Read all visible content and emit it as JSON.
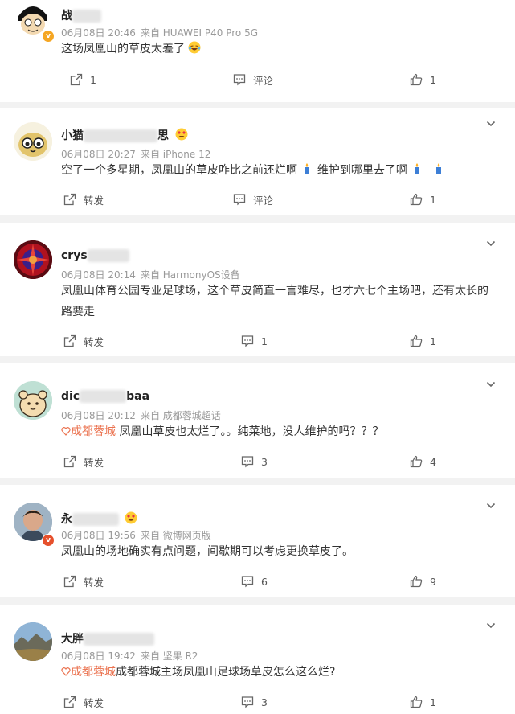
{
  "posts": [
    {
      "name_visible": "战",
      "time": "06月08日 20:46",
      "source": "来自 HUAWEI P40 Pro 5G",
      "text": "这场凤凰山的草皮太差了",
      "text_suffix_emoji": "laugh-cry-emoji",
      "actions": {
        "share": "1",
        "comment": "评论",
        "like": "1"
      }
    },
    {
      "name_visible": "小猫",
      "name_visible_end": "思",
      "time": "06月08日 20:27",
      "source": "来自 iPhone 12",
      "text_a": "空了一个多星期，凤凰山的草皮咋比之前还烂啊",
      "text_b": "维护到哪里去了啊",
      "actions": {
        "share": "转发",
        "comment": "评论",
        "like": "1"
      }
    },
    {
      "name_visible": "crys",
      "time": "06月08日 20:14",
      "source": "来自 HarmonyOS设备",
      "text": "凤凰山体育公园专业足球场，这个草皮简直一言难尽，也才六七个主场吧，还有太长的路要走",
      "actions": {
        "share": "转发",
        "comment": "1",
        "like": "1"
      }
    },
    {
      "name_visible": "dic",
      "name_visible_end": "baa",
      "time": "06月08日 20:12",
      "source": "来自 成都蓉城超话",
      "tag": "成都蓉城",
      "text": "凤凰山草皮也太烂了。。纯菜地，没人维护的吗？？？",
      "actions": {
        "share": "转发",
        "comment": "3",
        "like": "4"
      }
    },
    {
      "name_visible": "永",
      "time": "06月08日 19:56",
      "source": "来自 微博网页版",
      "text": "凤凰山的场地确实有点问题，间歇期可以考虑更换草皮了。",
      "actions": {
        "share": "转发",
        "comment": "6",
        "like": "9"
      }
    },
    {
      "name_visible": "大胖",
      "time": "06月08日 19:42",
      "source": "来自 坚果 R2",
      "tag": "成都蓉城",
      "text": "成都蓉城主场凤凰山足球场草皮怎么这么烂?",
      "actions": {
        "share": "转发",
        "comment": "3",
        "like": "1"
      }
    }
  ],
  "colors": {
    "accent_tag": "#eb7350",
    "meta": "#999999",
    "bg": "#f2f2f2"
  }
}
